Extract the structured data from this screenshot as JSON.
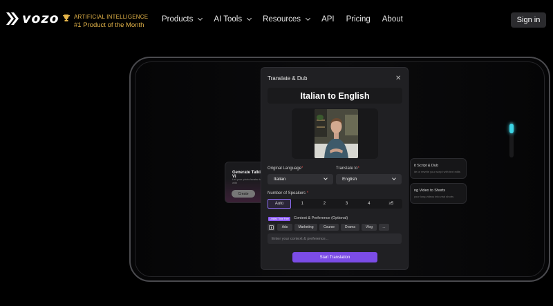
{
  "header": {
    "logo_text": "vozo",
    "award_line1": "ARTIFICIAL INTELLIGENCE",
    "award_line2": "#1 Product of the Month",
    "menu": [
      {
        "label": "Products",
        "has_dropdown": true
      },
      {
        "label": "AI Tools",
        "has_dropdown": true
      },
      {
        "label": "Resources",
        "has_dropdown": true
      },
      {
        "label": "API",
        "has_dropdown": false
      },
      {
        "label": "Pricing",
        "has_dropdown": false
      },
      {
        "label": "About",
        "has_dropdown": false
      }
    ],
    "signin_label": "Sign in"
  },
  "background_cards": {
    "left": {
      "title": "Generate Talking Vi",
      "subtitle": "Let your photo/avatar talk with",
      "button": "Create"
    },
    "right1": {
      "title": "it Script & Dub",
      "subtitle": "ite or rewrite your script with text edits"
    },
    "right2": {
      "title": "ng Video to Shorts",
      "subtitle": "your long videos into viral shorts"
    }
  },
  "modal": {
    "title": "Translate & Dub",
    "header": "Italian to English",
    "original_language_label": "Original Language",
    "original_language_value": "Italian",
    "translate_to_label": "Translate to",
    "translate_to_value": "English",
    "speakers_label": "Number of Speakers",
    "speakers": [
      "Auto",
      "1",
      "2",
      "3",
      "4",
      "≥5"
    ],
    "speakers_selected": "Auto",
    "beta_badge": "Limited Time Free",
    "context_label": "Context & Preference (Optional)",
    "chips": [
      "Ads",
      "Marketing",
      "Course",
      "Drama",
      "Vlog",
      "..."
    ],
    "context_placeholder": "Enter your context & preference...",
    "start_button": "Start Translation"
  },
  "colors": {
    "accent": "#7b4ce6",
    "gold": "#e6b64a",
    "cyan": "#3dd5e6"
  }
}
